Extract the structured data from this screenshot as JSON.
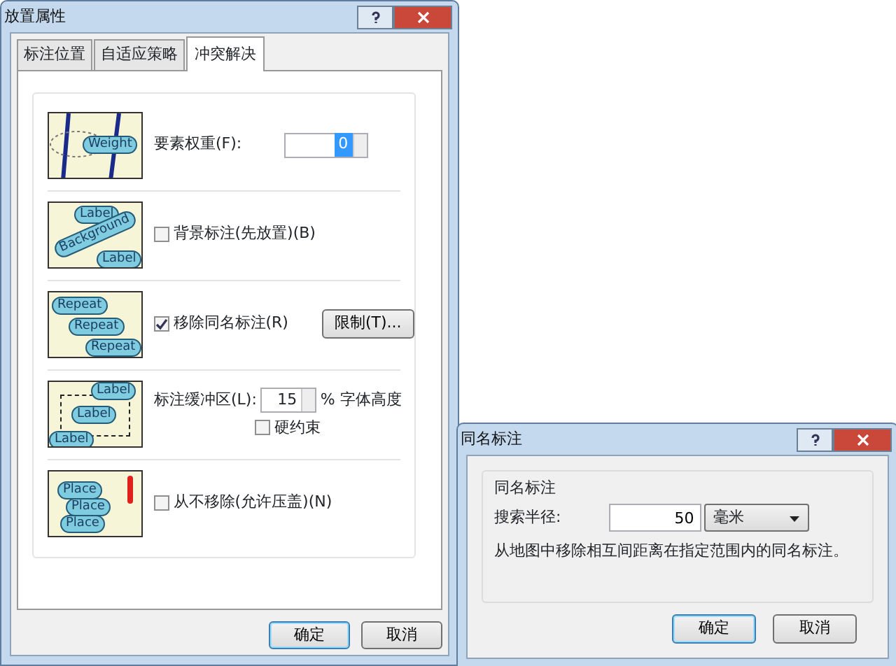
{
  "left_window": {
    "title": "放置属性",
    "tabs": [
      {
        "label": "标注位置",
        "selected": false
      },
      {
        "label": "自适应策略",
        "selected": false
      },
      {
        "label": "冲突解决",
        "selected": true
      }
    ],
    "sections": [
      {
        "kind": "spin",
        "illustration": {
          "kind": "weight",
          "labels": [
            "Weight"
          ]
        },
        "label": "要素权重(F):",
        "value": "0"
      },
      {
        "kind": "checkbox",
        "illustration": {
          "kind": "background",
          "labels": [
            "Label",
            "Background",
            "Label"
          ]
        },
        "label": "背景标注(先放置)(B)",
        "checked": false
      },
      {
        "kind": "checkbox_button",
        "illustration": {
          "kind": "repeat",
          "labels": [
            "Repeat",
            "Repeat",
            "Repeat"
          ]
        },
        "label": "移除同名标注(R)",
        "checked": true,
        "button": "限制(T)..."
      },
      {
        "kind": "buffer",
        "illustration": {
          "kind": "buffer",
          "labels": [
            "Label",
            "Label",
            "Label"
          ]
        },
        "label": "标注缓冲区(L):",
        "value": "15",
        "unit": "% 字体高度",
        "option": {
          "label": "硬约束",
          "checked": false
        }
      },
      {
        "kind": "checkbox",
        "illustration": {
          "kind": "place",
          "labels": [
            "Place",
            "Place",
            "Place"
          ]
        },
        "label": "从不移除(允许压盖)(N)",
        "checked": false
      }
    ],
    "buttons": [
      {
        "label": "确定",
        "default": true
      },
      {
        "label": "取消",
        "default": false
      }
    ]
  },
  "right_window": {
    "title": "同名标注",
    "group": "同名标注",
    "field_label": "搜索半径:",
    "value": "50",
    "unit": "毫米",
    "description": "从地图中移除相互间距离在指定范围内的同名标注。",
    "buttons": [
      {
        "label": "确定",
        "default": true
      },
      {
        "label": "取消",
        "default": false
      }
    ]
  }
}
